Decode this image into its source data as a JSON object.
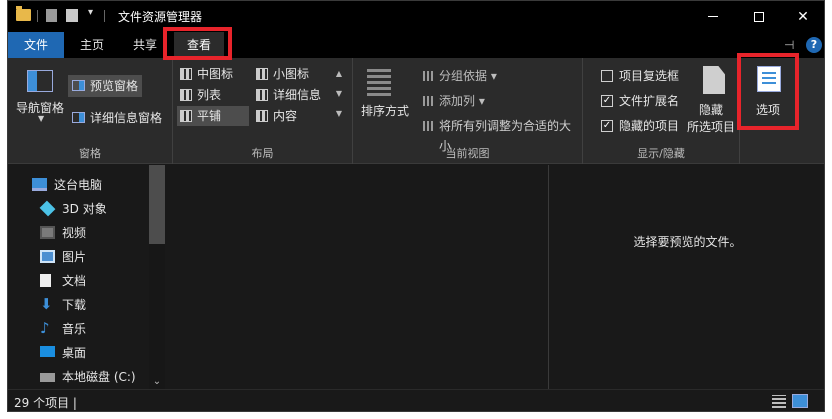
{
  "window": {
    "title": "文件资源管理器"
  },
  "tabs": [
    {
      "label": "文件"
    },
    {
      "label": "主页"
    },
    {
      "label": "共享"
    },
    {
      "label": "查看"
    }
  ],
  "ribbon": {
    "panes": {
      "group_label": "窗格",
      "nav_pane": "导航窗格",
      "preview_pane": "预览窗格",
      "details_pane": "详细信息窗格"
    },
    "layout": {
      "group_label": "布局",
      "items": [
        {
          "label": "中图标"
        },
        {
          "label": "小图标"
        },
        {
          "label": "列表"
        },
        {
          "label": "详细信息"
        },
        {
          "label": "平铺",
          "selected": true
        },
        {
          "label": "内容"
        }
      ]
    },
    "current_view": {
      "group_label": "当前视图",
      "sort_by": "排序方式",
      "group_by": "分组依据",
      "add_columns": "添加列",
      "fit_columns": "将所有列调整为合适的大小"
    },
    "show_hide": {
      "group_label": "显示/隐藏",
      "item_checkboxes": {
        "label": "项目复选框",
        "checked": false
      },
      "file_extensions": {
        "label": "文件扩展名",
        "checked": true
      },
      "hidden_items": {
        "label": "隐藏的项目",
        "checked": true
      },
      "hide_selected": "隐藏",
      "hide_selected_2": "所选项目"
    },
    "options": {
      "label": "选项"
    }
  },
  "nav": {
    "items": [
      {
        "label": "这台电脑",
        "icon": "computer-icon"
      },
      {
        "label": "3D 对象",
        "icon": "cube-icon"
      },
      {
        "label": "视频",
        "icon": "video-icon"
      },
      {
        "label": "图片",
        "icon": "picture-icon"
      },
      {
        "label": "文档",
        "icon": "document-icon"
      },
      {
        "label": "下载",
        "icon": "download-icon"
      },
      {
        "label": "音乐",
        "icon": "music-icon"
      },
      {
        "label": "桌面",
        "icon": "desktop-icon"
      },
      {
        "label": "本地磁盘 (C:)",
        "icon": "drive-icon"
      }
    ]
  },
  "preview": {
    "message": "选择要预览的文件。"
  },
  "status": {
    "count": "29 个项目 |"
  },
  "colors": {
    "accent": "#1f68b3",
    "highlight": "#e8242b"
  }
}
